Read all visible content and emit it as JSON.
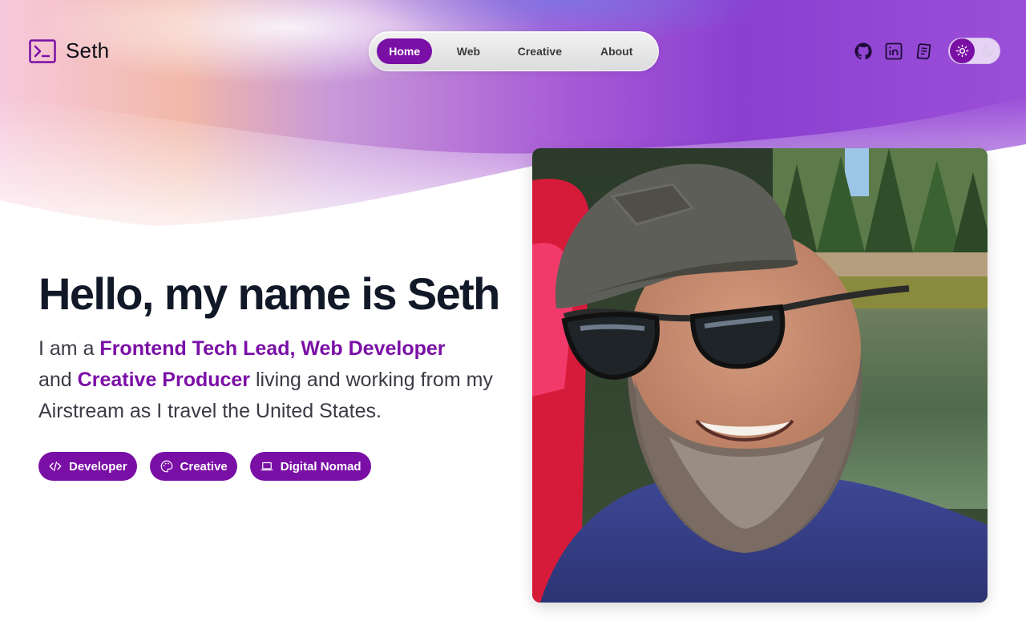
{
  "brand": {
    "name": "Seth",
    "icon": "terminal-icon",
    "accent": "#7a0fa6"
  },
  "nav": {
    "items": [
      {
        "label": "Home",
        "active": true
      },
      {
        "label": "Web",
        "active": false
      },
      {
        "label": "Creative",
        "active": false
      },
      {
        "label": "About",
        "active": false
      }
    ]
  },
  "social": [
    {
      "icon": "github-icon"
    },
    {
      "icon": "linkedin-icon"
    },
    {
      "icon": "resume-icon"
    }
  ],
  "theme_toggle": {
    "mode": "light",
    "icons": [
      "sun-icon",
      "moon-icon"
    ]
  },
  "hero": {
    "title": "Hello, my name is Seth",
    "desc_prefix": "I am a ",
    "role1": "Frontend Tech Lead, Web Developer",
    "desc_and": "and ",
    "role2": "Creative Producer",
    "desc_suffix": " living and working from my Airstream as I travel the United States."
  },
  "tags": [
    {
      "label": "Developer",
      "icon": "code-icon"
    },
    {
      "label": "Creative",
      "icon": "palette-icon"
    },
    {
      "label": "Digital Nomad",
      "icon": "laptop-icon"
    }
  ],
  "photo": {
    "icon": "portrait-photo"
  }
}
